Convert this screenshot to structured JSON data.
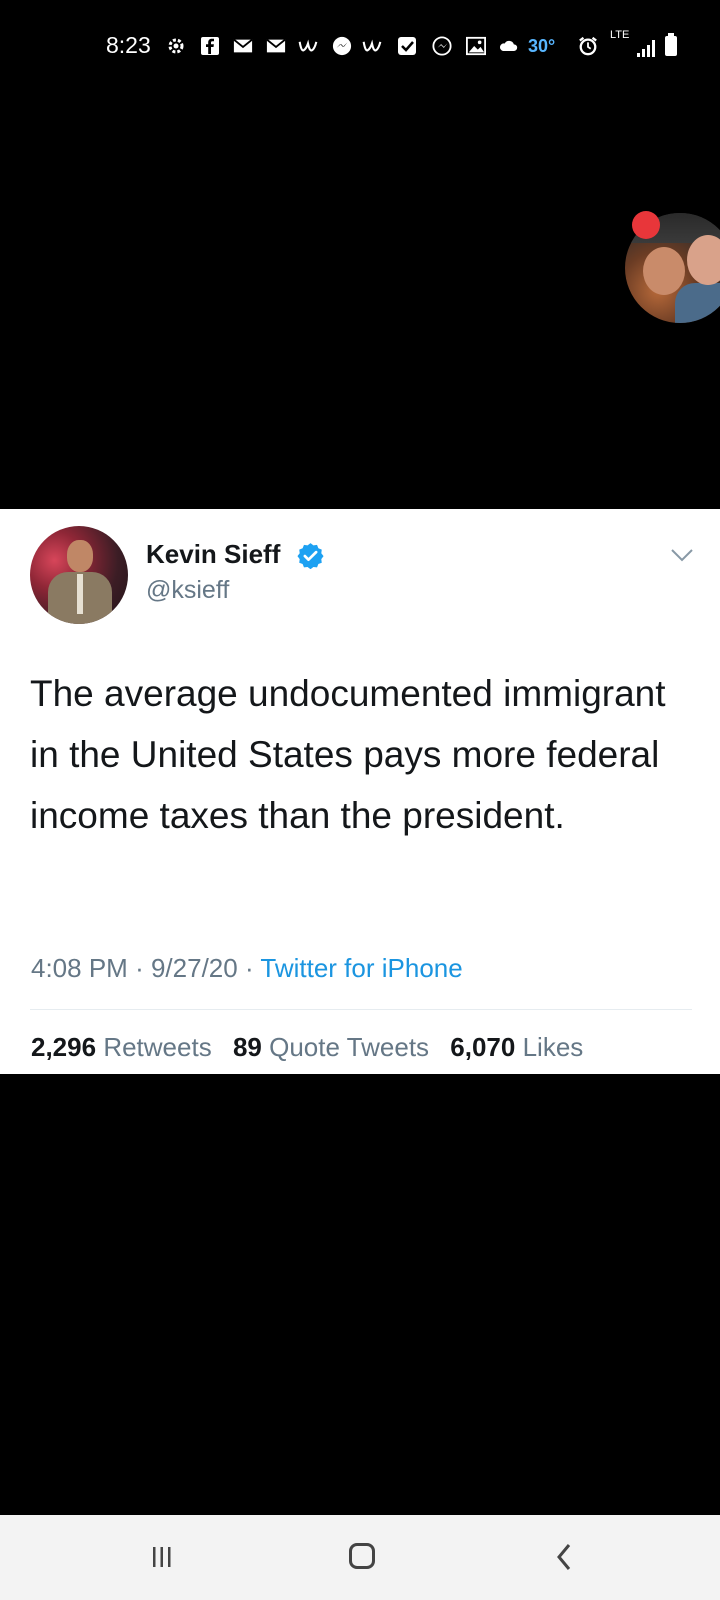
{
  "status_bar": {
    "time": "8:23",
    "temperature": "30°",
    "network": "LTE",
    "icons": [
      "settings-icon",
      "facebook-icon",
      "gmail-icon",
      "gmail-icon",
      "weather-app-icon",
      "messenger-icon",
      "weather-app-icon",
      "checkbox-icon",
      "messenger-icon",
      "gallery-icon",
      "cloud-icon",
      "alarm-icon",
      "signal-icon",
      "battery-icon"
    ]
  },
  "tweet": {
    "name": "Kevin Sieff",
    "handle": "@ksieff",
    "text": "The average undocumented immigrant in the United States pays more federal income taxes than the president.",
    "time": "4:08 PM",
    "date": "9/27/20",
    "separator": "·",
    "source": "Twitter for iPhone",
    "stats": [
      {
        "count": "2,296",
        "label": "Retweets"
      },
      {
        "count": "89",
        "label": "Quote Tweets"
      },
      {
        "count": "6,070",
        "label": "Likes"
      }
    ]
  },
  "colors": {
    "text": "#14171a",
    "secondary": "#657786",
    "link": "#1b95e0",
    "verified": "#1da1f2"
  }
}
